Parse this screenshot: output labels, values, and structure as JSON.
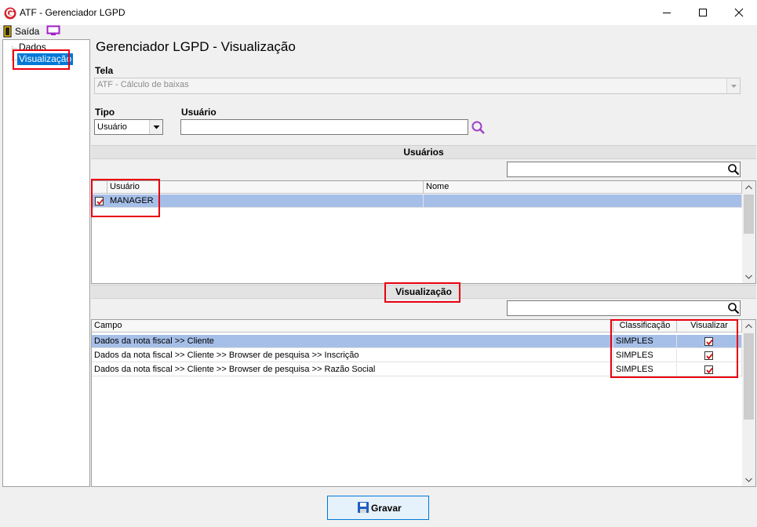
{
  "window": {
    "title": "ATF - Gerenciador LGPD",
    "minimize_glyph": "–",
    "maximize_glyph": "☐",
    "close_glyph": "✕"
  },
  "menu": {
    "exit_label": "Saída"
  },
  "tree": {
    "items": [
      {
        "label": "Dados"
      },
      {
        "label": "Visualização"
      }
    ]
  },
  "main": {
    "title": "Gerenciador LGPD - Visualização",
    "tela_label": "Tela",
    "tela_value": "ATF - Cálculo de baixas",
    "tipo_label": "Tipo",
    "tipo_value": "Usuário",
    "usuario_label": "Usuário",
    "usuario_value": ""
  },
  "usuarios_section": {
    "title": "Usuários",
    "filter_value": "",
    "columns": [
      "Usuário",
      "Nome"
    ],
    "rows": [
      {
        "usuario": "MANAGER",
        "nome": "",
        "checked": true
      }
    ]
  },
  "visualizacao_section": {
    "title": "Visualização",
    "filter_value": "",
    "columns": [
      "Campo",
      "Classificação",
      "Visualizar"
    ],
    "rows": [
      {
        "campo": "Dados da nota fiscal >> Cliente",
        "classificacao": "SIMPLES",
        "visualizar": true
      },
      {
        "campo": "Dados da nota fiscal >> Cliente >> Browser de pesquisa >> Inscrição",
        "classificacao": "SIMPLES",
        "visualizar": true
      },
      {
        "campo": "Dados da nota fiscal >> Cliente >> Browser de pesquisa >> Razão Social",
        "classificacao": "SIMPLES",
        "visualizar": true
      }
    ]
  },
  "footer": {
    "save_label": "Gravar"
  },
  "colors": {
    "accent": "#0078d7",
    "selection": "#a6bfe8",
    "annotation": "#e8000e",
    "logo": "#d3202a"
  },
  "icons": [
    "app-logo-icon",
    "exit-door-icon",
    "monitor-icon",
    "search-icon",
    "magnifier-icon",
    "floppy-disk-icon",
    "checkmark-icon",
    "chevron-down-icon"
  ]
}
